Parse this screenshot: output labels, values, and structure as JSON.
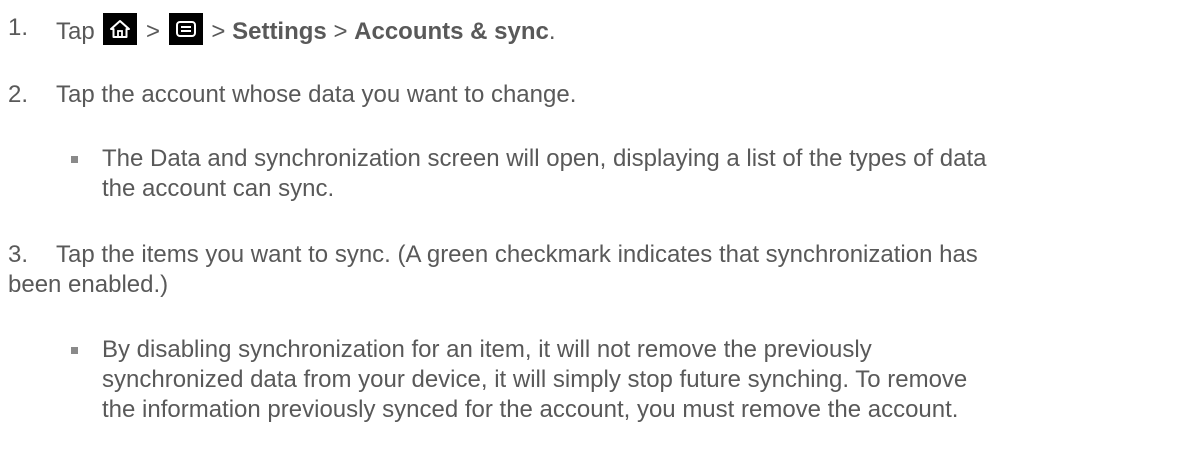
{
  "steps": [
    {
      "number": "1.",
      "parts": {
        "tap": "Tap",
        "sep1": ">",
        "sep2": ">",
        "settings": "Settings",
        "sep3": ">",
        "accounts": "Accounts & sync",
        "end": "."
      },
      "icons": [
        "home-icon",
        "menu-icon"
      ]
    },
    {
      "number": "2.",
      "text": "Tap the account whose data you want to change."
    },
    {
      "number": "3.",
      "text_line1": "Tap the items you want to sync. (A green checkmark indicates that synchronization has",
      "text_line2": "been enabled.)"
    }
  ],
  "bullets": [
    {
      "line1": "The Data and synchronization screen will open, displaying a list of the types of data",
      "line2": "the account can sync."
    },
    {
      "line1": "By disabling synchronization for an item, it will not remove the previously",
      "line2": "synchronized data from your device, it will simply stop future synching. To remove",
      "line3": "the information previously synced for the account, you must remove the account."
    }
  ],
  "colors": {
    "text": "#595959",
    "key_background": "#000000",
    "key_glyph": "#ffffff"
  }
}
